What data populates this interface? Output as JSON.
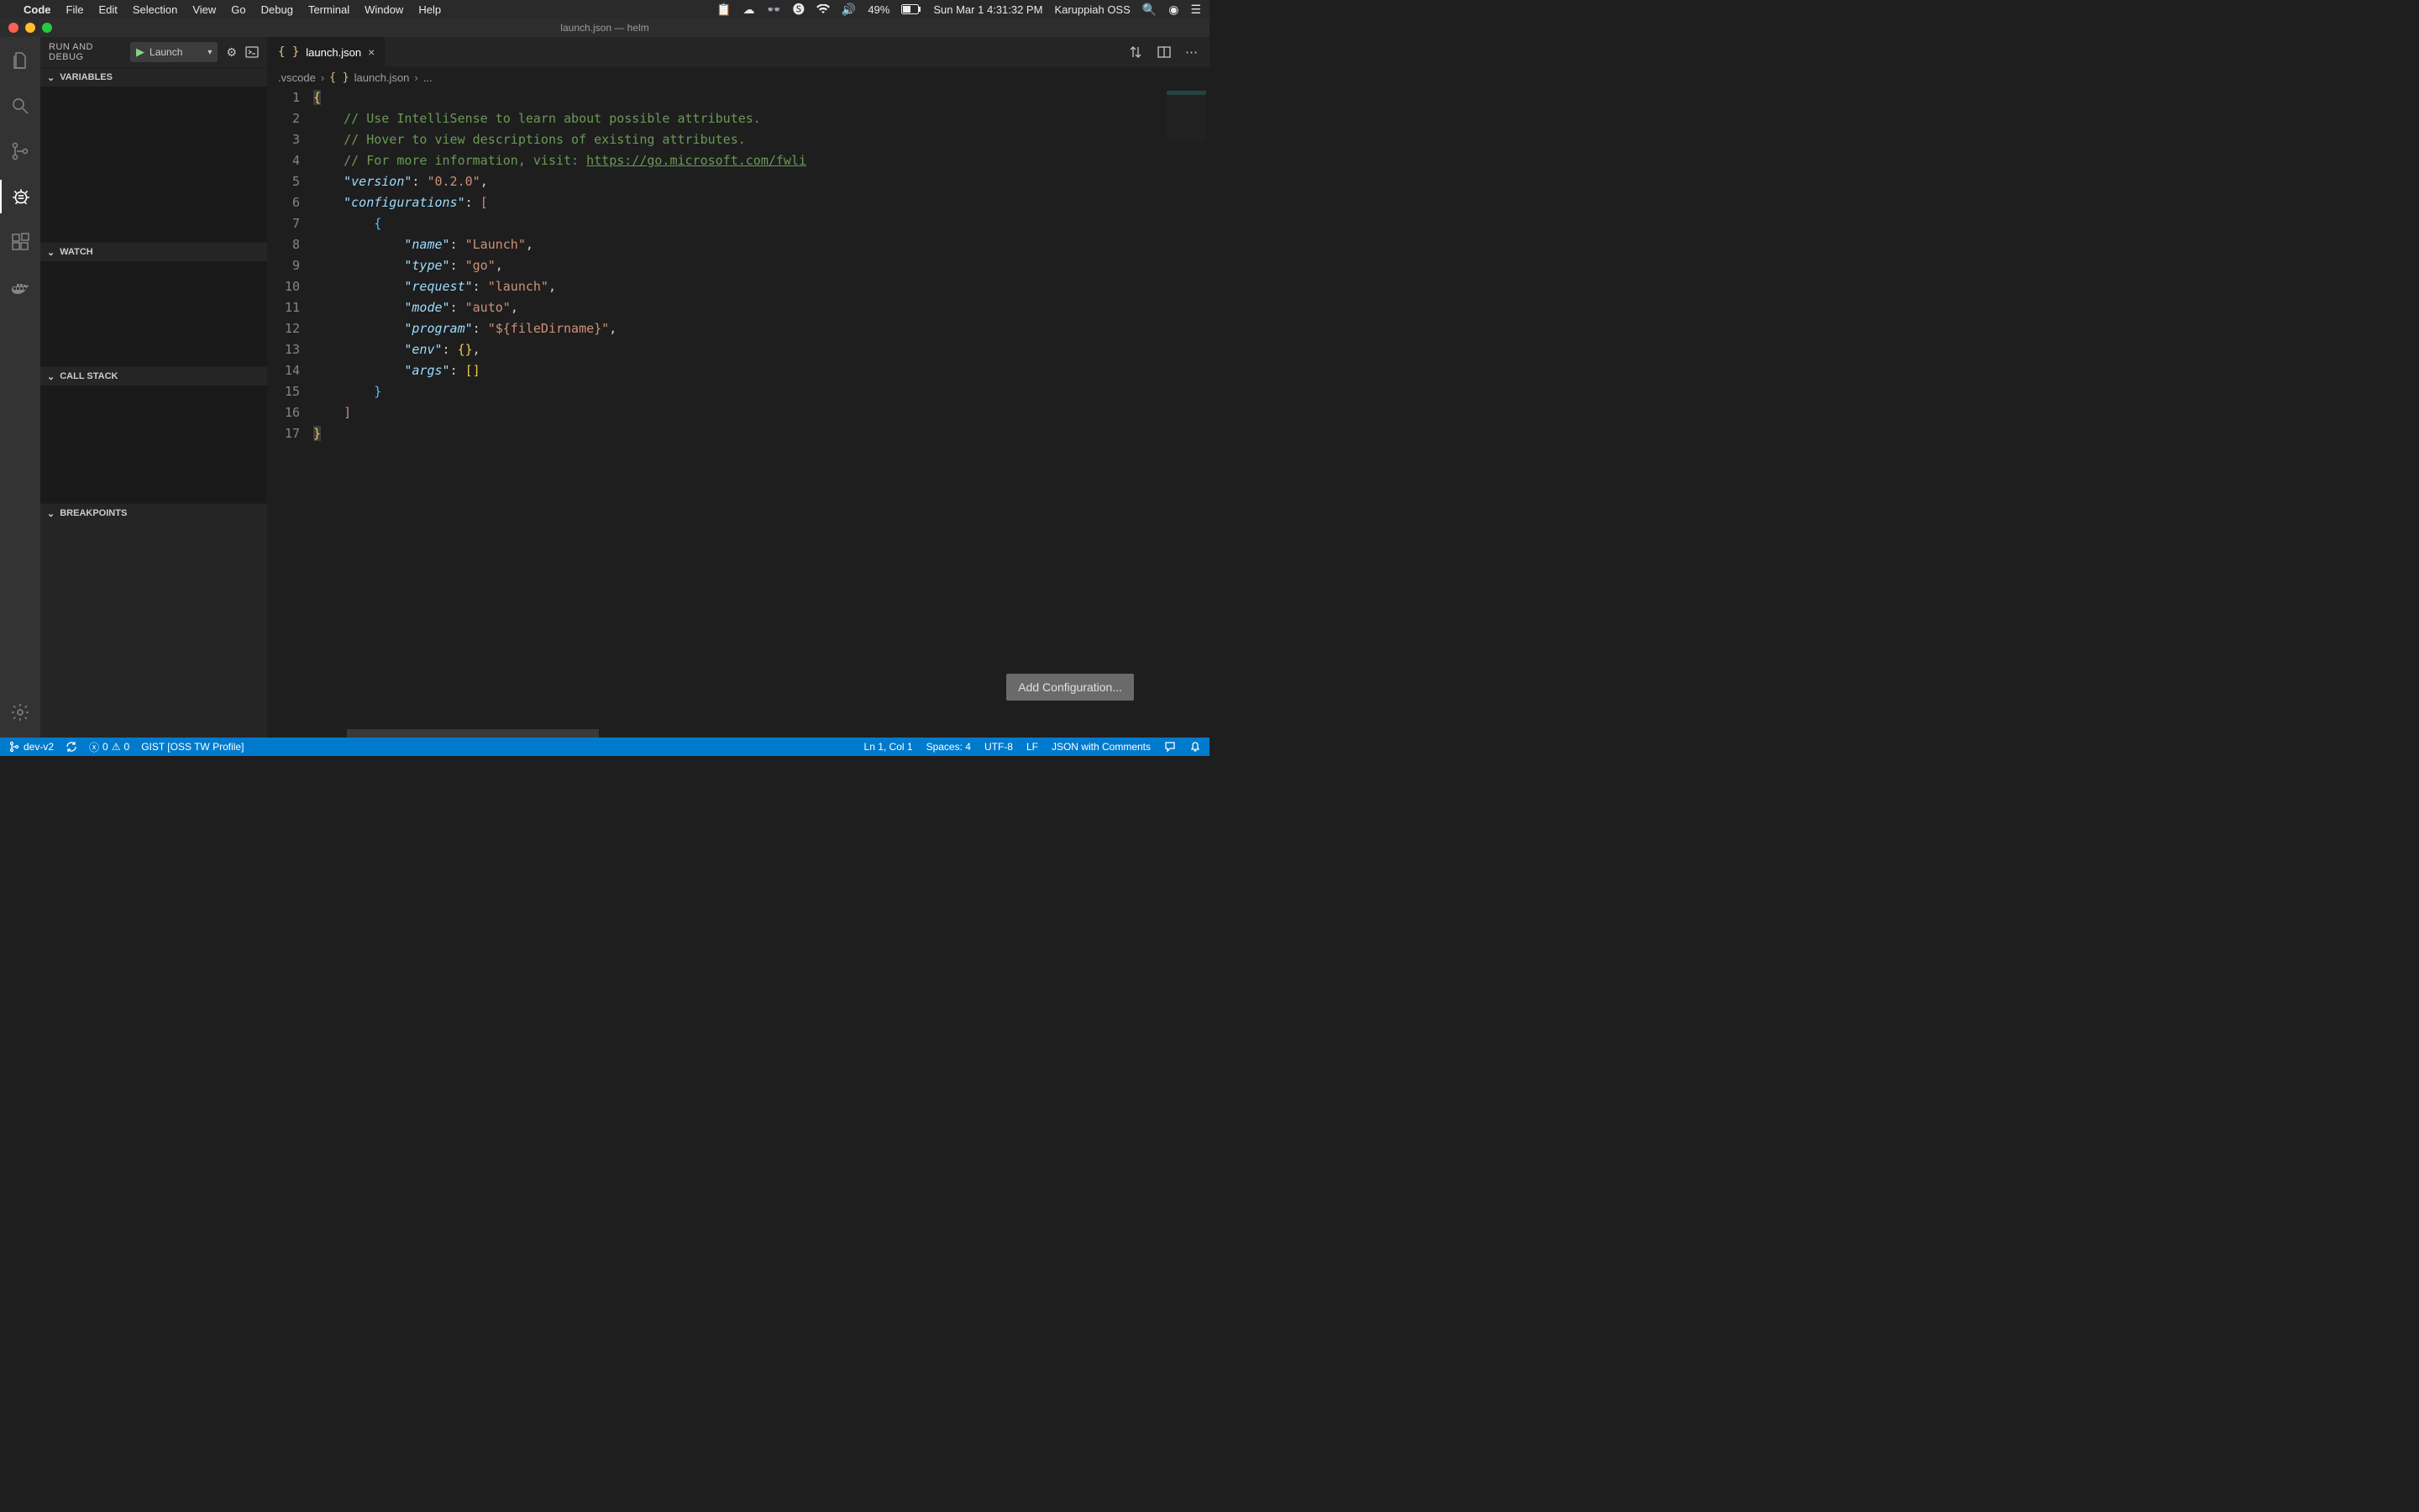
{
  "mac_menu": {
    "app": "Code",
    "items": [
      "File",
      "Edit",
      "Selection",
      "View",
      "Go",
      "Debug",
      "Terminal",
      "Window",
      "Help"
    ],
    "battery": "49%",
    "datetime": "Sun Mar 1  4:31:32 PM",
    "username": "Karuppiah OSS"
  },
  "window": {
    "title": "launch.json — helm"
  },
  "sidebar": {
    "title": "RUN AND DEBUG",
    "config_name": "Launch",
    "sections": {
      "variables": "VARIABLES",
      "watch": "WATCH",
      "callstack": "CALL STACK",
      "breakpoints": "BREAKPOINTS"
    }
  },
  "activitybar": {
    "icons": [
      "files",
      "search",
      "git",
      "debug",
      "extensions",
      "docker"
    ],
    "active": "debug"
  },
  "editor": {
    "tab_name": "launch.json",
    "breadcrumbs": [
      ".vscode",
      "launch.json",
      "..."
    ],
    "add_config_btn": "Add Configuration...",
    "line_count": 17,
    "code_lines": [
      {
        "n": 1,
        "segments": [
          {
            "t": "{",
            "c": "bracket-y highlight-brace"
          }
        ]
      },
      {
        "n": 2,
        "segments": [
          {
            "t": "    ",
            "c": ""
          },
          {
            "t": "// Use IntelliSense to learn about possible attributes.",
            "c": "comment"
          }
        ]
      },
      {
        "n": 3,
        "segments": [
          {
            "t": "    ",
            "c": ""
          },
          {
            "t": "// Hover to view descriptions of existing attributes.",
            "c": "comment"
          }
        ]
      },
      {
        "n": 4,
        "segments": [
          {
            "t": "    ",
            "c": ""
          },
          {
            "t": "// For more information, visit: ",
            "c": "comment"
          },
          {
            "t": "https://go.microsoft.com/fwli",
            "c": "comment underline"
          }
        ]
      },
      {
        "n": 5,
        "segments": [
          {
            "t": "    ",
            "c": ""
          },
          {
            "t": "\"version\"",
            "c": "key"
          },
          {
            "t": ": ",
            "c": ""
          },
          {
            "t": "\"0.2.0\"",
            "c": "string"
          },
          {
            "t": ",",
            "c": ""
          }
        ]
      },
      {
        "n": 6,
        "segments": [
          {
            "t": "    ",
            "c": ""
          },
          {
            "t": "\"configurations\"",
            "c": "key"
          },
          {
            "t": ": ",
            "c": ""
          },
          {
            "t": "[",
            "c": "bracket-p"
          }
        ]
      },
      {
        "n": 7,
        "segments": [
          {
            "t": "        ",
            "c": ""
          },
          {
            "t": "{",
            "c": "bracket-b"
          }
        ]
      },
      {
        "n": 8,
        "segments": [
          {
            "t": "            ",
            "c": ""
          },
          {
            "t": "\"name\"",
            "c": "key"
          },
          {
            "t": ": ",
            "c": ""
          },
          {
            "t": "\"Launch\"",
            "c": "string"
          },
          {
            "t": ",",
            "c": ""
          }
        ]
      },
      {
        "n": 9,
        "segments": [
          {
            "t": "            ",
            "c": ""
          },
          {
            "t": "\"type\"",
            "c": "key"
          },
          {
            "t": ": ",
            "c": ""
          },
          {
            "t": "\"go\"",
            "c": "string"
          },
          {
            "t": ",",
            "c": ""
          }
        ]
      },
      {
        "n": 10,
        "segments": [
          {
            "t": "            ",
            "c": ""
          },
          {
            "t": "\"request\"",
            "c": "key"
          },
          {
            "t": ": ",
            "c": ""
          },
          {
            "t": "\"launch\"",
            "c": "string"
          },
          {
            "t": ",",
            "c": ""
          }
        ]
      },
      {
        "n": 11,
        "segments": [
          {
            "t": "            ",
            "c": ""
          },
          {
            "t": "\"mode\"",
            "c": "key"
          },
          {
            "t": ": ",
            "c": ""
          },
          {
            "t": "\"auto\"",
            "c": "string"
          },
          {
            "t": ",",
            "c": ""
          }
        ]
      },
      {
        "n": 12,
        "segments": [
          {
            "t": "            ",
            "c": ""
          },
          {
            "t": "\"program\"",
            "c": "key"
          },
          {
            "t": ": ",
            "c": ""
          },
          {
            "t": "\"${fileDirname}\"",
            "c": "string"
          },
          {
            "t": ",",
            "c": ""
          }
        ]
      },
      {
        "n": 13,
        "segments": [
          {
            "t": "            ",
            "c": ""
          },
          {
            "t": "\"env\"",
            "c": "key"
          },
          {
            "t": ": ",
            "c": ""
          },
          {
            "t": "{}",
            "c": "bracket-y"
          },
          {
            "t": ",",
            "c": ""
          }
        ]
      },
      {
        "n": 14,
        "segments": [
          {
            "t": "            ",
            "c": ""
          },
          {
            "t": "\"args\"",
            "c": "key"
          },
          {
            "t": ": ",
            "c": ""
          },
          {
            "t": "[]",
            "c": "bracket-y"
          }
        ]
      },
      {
        "n": 15,
        "segments": [
          {
            "t": "        ",
            "c": ""
          },
          {
            "t": "}",
            "c": "bracket-b"
          }
        ]
      },
      {
        "n": 16,
        "segments": [
          {
            "t": "    ",
            "c": ""
          },
          {
            "t": "]",
            "c": "bracket-p"
          }
        ]
      },
      {
        "n": 17,
        "segments": [
          {
            "t": "}",
            "c": "bracket-y highlight-brace"
          }
        ]
      }
    ]
  },
  "statusbar": {
    "branch": "dev-v2",
    "errors": "0",
    "warnings": "0",
    "profile": "GIST [OSS TW Profile]",
    "cursor": "Ln 1, Col 1",
    "spaces": "Spaces: 4",
    "encoding": "UTF-8",
    "eol": "LF",
    "language": "JSON with Comments"
  }
}
